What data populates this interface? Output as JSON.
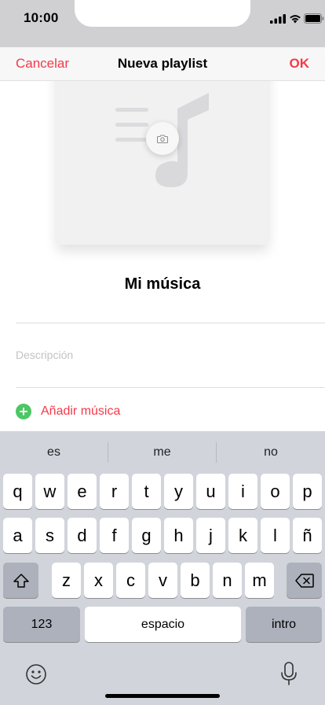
{
  "status_bar": {
    "time": "10:00"
  },
  "nav": {
    "cancel_label": "Cancelar",
    "title": "Nueva playlist",
    "ok_label": "OK"
  },
  "artwork": {
    "placeholder_icon": "music-note-list-icon",
    "camera_icon": "camera-icon"
  },
  "playlist": {
    "name": "Mi música",
    "description_placeholder": "Descripción",
    "description_value": "",
    "add_music_label": "Añadir música"
  },
  "keyboard": {
    "suggestions": [
      "es",
      "me",
      "no"
    ],
    "row1": [
      "q",
      "w",
      "e",
      "r",
      "t",
      "y",
      "u",
      "i",
      "o",
      "p"
    ],
    "row2": [
      "a",
      "s",
      "d",
      "f",
      "g",
      "h",
      "j",
      "k",
      "l",
      "ñ"
    ],
    "row3": [
      "z",
      "x",
      "c",
      "v",
      "b",
      "n",
      "m"
    ],
    "numbers_label": "123",
    "space_label": "espacio",
    "return_label": "intro"
  },
  "colors": {
    "accent": "#f5394a",
    "add_icon": "#4cc764",
    "keyboard_bg": "#d1d4db"
  }
}
